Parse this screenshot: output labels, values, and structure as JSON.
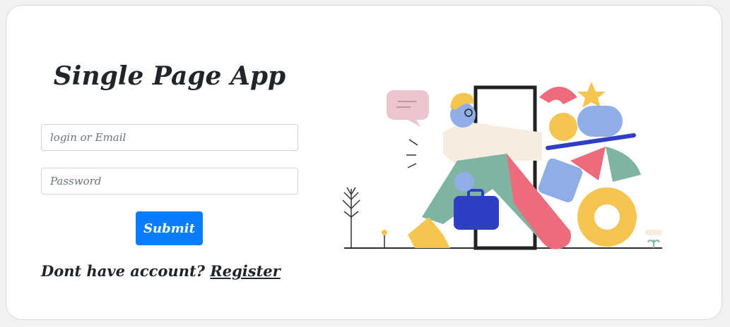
{
  "app": {
    "title": "Single Page App"
  },
  "form": {
    "login_placeholder": "login or Email",
    "password_placeholder": "Password",
    "submit_label": "Submit"
  },
  "footer": {
    "prompt": "Dont have account? ",
    "register_label": "Register"
  },
  "colors": {
    "primary": "#0a7cff",
    "text": "#212529"
  },
  "icons": {
    "illustration": "person-walking-through-door-illustration"
  }
}
